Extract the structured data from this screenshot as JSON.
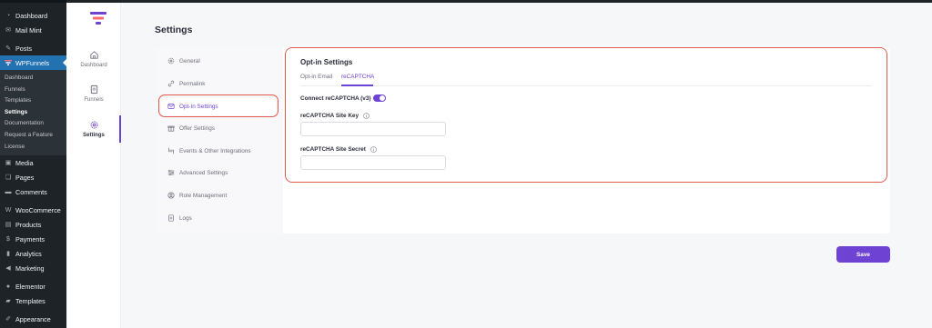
{
  "wp_menu": [
    {
      "label": "Dashboard",
      "icon": "dashboard-icon"
    },
    {
      "label": "Mail Mint",
      "icon": "mail-icon"
    },
    {
      "label": "Posts",
      "icon": "pin-icon"
    },
    {
      "label": "WPFunnels",
      "icon": "funnel-icon"
    },
    {
      "label": "Media",
      "icon": "media-icon"
    },
    {
      "label": "Pages",
      "icon": "pages-icon"
    },
    {
      "label": "Comments",
      "icon": "comments-icon"
    },
    {
      "label": "WooCommerce",
      "icon": "woo-icon"
    },
    {
      "label": "Products",
      "icon": "products-icon"
    },
    {
      "label": "Payments",
      "icon": "payments-icon"
    },
    {
      "label": "Analytics",
      "icon": "analytics-icon"
    },
    {
      "label": "Marketing",
      "icon": "marketing-icon"
    },
    {
      "label": "Elementor",
      "icon": "elementor-icon"
    },
    {
      "label": "Templates",
      "icon": "templates-icon"
    },
    {
      "label": "Appearance",
      "icon": "appearance-icon"
    }
  ],
  "wp_submenu": [
    "Dashboard",
    "Funnels",
    "Templates",
    "Settings",
    "Documentation",
    "Request a Feature",
    "License"
  ],
  "plugin_nav": [
    {
      "label": "Dashboard",
      "icon": "home-icon"
    },
    {
      "label": "Funnels",
      "icon": "document-icon"
    },
    {
      "label": "Settings",
      "icon": "gear-icon"
    }
  ],
  "page_title": "Settings",
  "settings_menu": [
    {
      "label": "General",
      "icon": "gear-icon"
    },
    {
      "label": "Permalink",
      "icon": "link-icon"
    },
    {
      "label": "Opt-In Settings",
      "icon": "envelope-icon"
    },
    {
      "label": "Offer Settings",
      "icon": "gift-icon"
    },
    {
      "label": "Events & Other Integrations",
      "icon": "integrations-icon"
    },
    {
      "label": "Advanced Settings",
      "icon": "sliders-icon"
    },
    {
      "label": "Role Management",
      "icon": "user-icon"
    },
    {
      "label": "Logs",
      "icon": "logs-icon"
    }
  ],
  "panel": {
    "title": "Opt-in Settings",
    "tabs": [
      "Opt-in Email",
      "reCAPTCHA"
    ],
    "active_tab": "reCAPTCHA",
    "connect_label": "Connect reCAPTCHA (v3)",
    "connect_enabled": true,
    "site_key_label": "reCAPTCHA Site Key",
    "site_key_value": "",
    "site_secret_label": "reCAPTCHA Site Secret",
    "site_secret_value": ""
  },
  "save_label": "Save",
  "colors": {
    "accent": "#6e42d3",
    "highlight": "#e05a4f",
    "wp_active": "#2271b1",
    "wp_sidebar": "#1d2327"
  }
}
